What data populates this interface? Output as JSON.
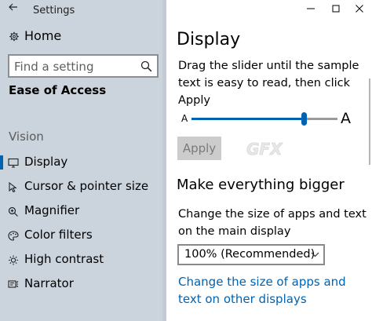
{
  "app": {
    "title": "Settings"
  },
  "nav": {
    "home": "Home",
    "search_placeholder": "Find a setting",
    "section": "Ease of Access",
    "group": "Vision",
    "items": [
      {
        "label": "Display",
        "icon": "monitor-icon",
        "selected": true
      },
      {
        "label": "Cursor & pointer size",
        "icon": "cursor-icon",
        "selected": false
      },
      {
        "label": "Magnifier",
        "icon": "magnifier-icon",
        "selected": false
      },
      {
        "label": "Color filters",
        "icon": "color-palette-icon",
        "selected": false
      },
      {
        "label": "High contrast",
        "icon": "contrast-sun-icon",
        "selected": false
      },
      {
        "label": "Narrator",
        "icon": "narrator-icon",
        "selected": false
      }
    ]
  },
  "main": {
    "title": "Display",
    "slider_description": "Drag the slider until the sample text is easy to read, then click Apply",
    "slider": {
      "small_label": "A",
      "large_label": "A",
      "value_fraction": 0.77
    },
    "apply_label": "Apply",
    "section_title": "Make everything bigger",
    "section_description": "Change the size of apps and text on the main display",
    "scale_selected": "100% (Recommended)",
    "link_text": "Change the size of apps and text on other displays"
  },
  "colors": {
    "accent": "#0063b1",
    "nav_background": "#cbd3dd",
    "disabled_button": "#cccccc"
  }
}
